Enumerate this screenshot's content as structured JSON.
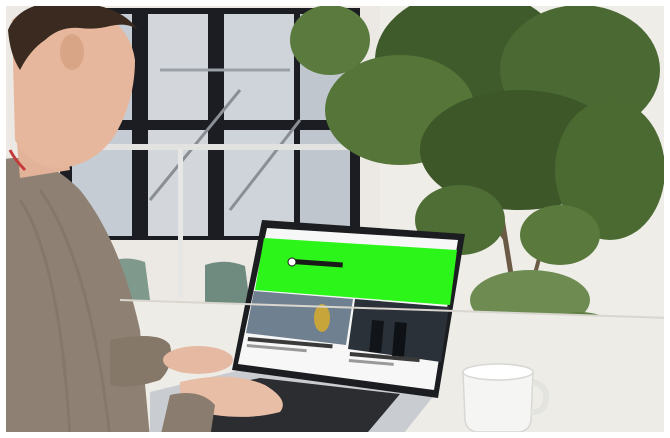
{
  "scene": {
    "description_tokens": [
      "office",
      "laptop",
      "plant",
      "coffee-mug",
      "person"
    ],
    "screen": {
      "accent_color": "#2cf51a",
      "site_header_text": "",
      "article_1_title": "",
      "article_2_title": ""
    },
    "colors": {
      "wall": "#ece9e4",
      "window_frame": "#1b1d22",
      "table": "#eeece6",
      "sweater": "#8e8173",
      "laptop_body": "#c9ccd1",
      "screen_bg": "#f7f7f7",
      "mug": "#f5f5f3"
    }
  }
}
